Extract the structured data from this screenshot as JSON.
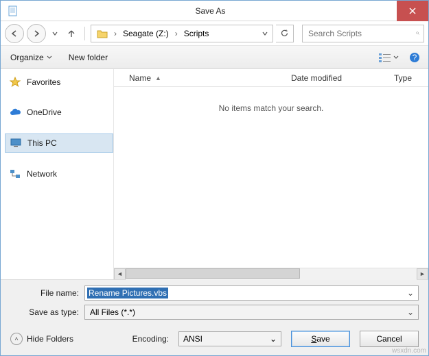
{
  "titlebar": {
    "title": "Save As"
  },
  "nav": {
    "breadcrumb": [
      {
        "label": "Seagate (Z:)"
      },
      {
        "label": "Scripts"
      }
    ],
    "search_placeholder": "Search Scripts"
  },
  "toolbar": {
    "organize": "Organize",
    "new_folder": "New folder"
  },
  "sidebar": {
    "items": [
      {
        "label": "Favorites"
      },
      {
        "label": "OneDrive"
      },
      {
        "label": "This PC"
      },
      {
        "label": "Network"
      }
    ]
  },
  "columns": {
    "name": "Name",
    "date": "Date modified",
    "type": "Type"
  },
  "list": {
    "empty_text": "No items match your search."
  },
  "fields": {
    "filename_label": "File name:",
    "filename_value": "Rename Pictures.vbs",
    "savetype_label": "Save as type:",
    "savetype_value": "All Files  (*.*)"
  },
  "footer": {
    "hide_folders": "Hide Folders",
    "encoding_label": "Encoding:",
    "encoding_value": "ANSI",
    "save": "Save",
    "cancel": "Cancel"
  },
  "watermark": "wsxdn.com"
}
